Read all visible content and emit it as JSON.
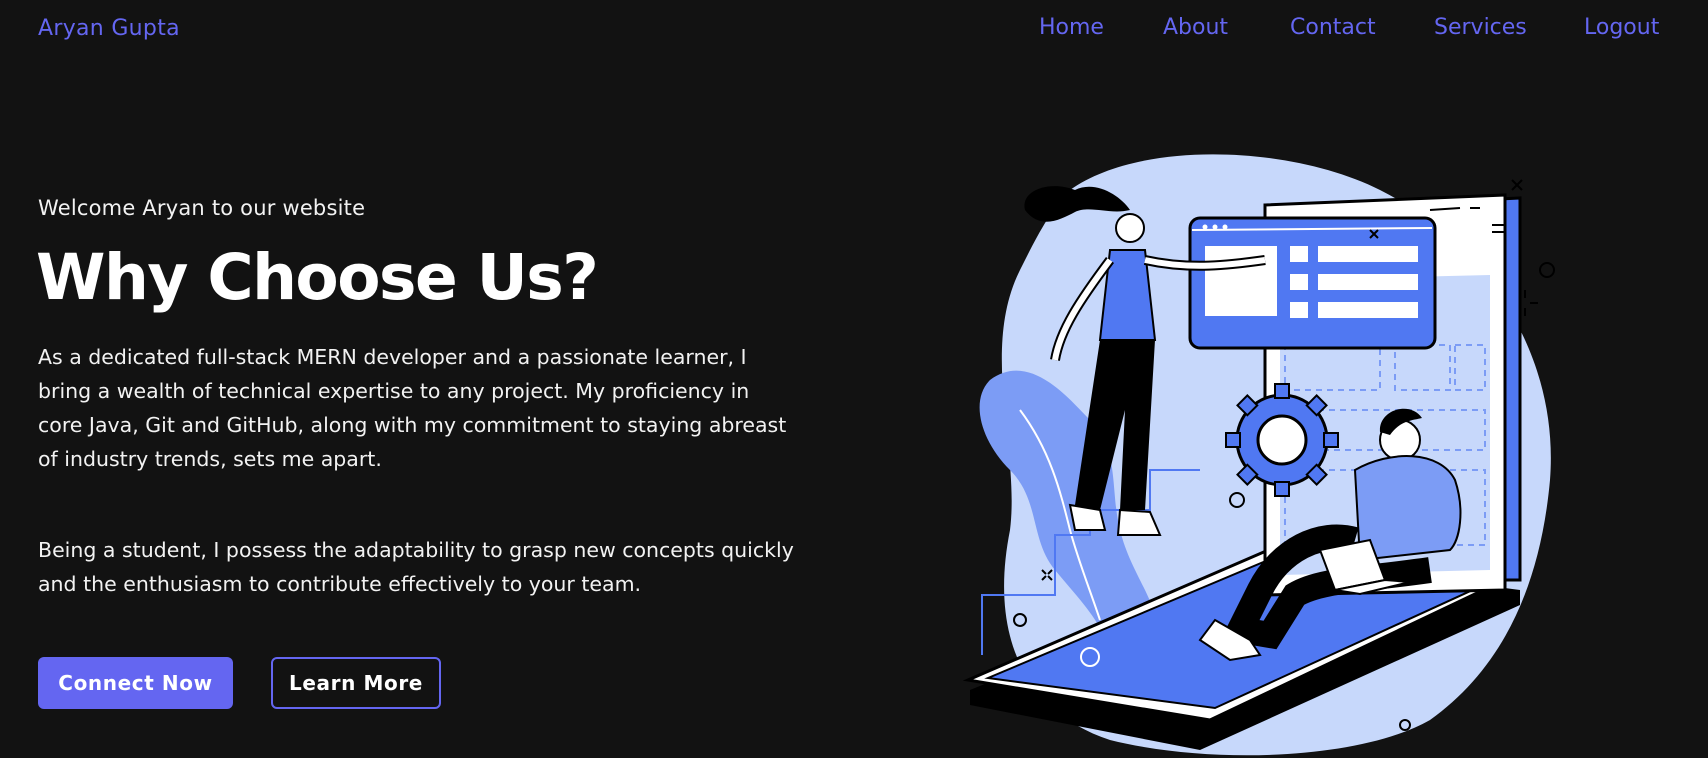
{
  "header": {
    "brand": "Aryan Gupta",
    "nav": [
      "Home",
      "About",
      "Contact",
      "Services",
      "Logout"
    ]
  },
  "hero": {
    "welcome": "Welcome Aryan to our website",
    "title": "Why Choose Us?",
    "paragraph1": "As a dedicated full-stack MERN developer and a passionate learner, I bring a wealth of technical expertise to any project. My proficiency in core Java, Git and GitHub, along with my commitment to staying abreast of industry trends, sets me apart.",
    "paragraph2": "Being a student, I possess the adaptability to grasp new concepts quickly and the enthusiasm to contribute effectively to your team.",
    "primary_button": "Connect Now",
    "secondary_button": "Learn More"
  },
  "colors": {
    "background": "#121212",
    "accent": "#6466f1",
    "illustration_blue": "#5078f2",
    "illustration_light": "#c7d8fb"
  },
  "icons": {
    "illustration": "developers-with-phone-illustration"
  }
}
